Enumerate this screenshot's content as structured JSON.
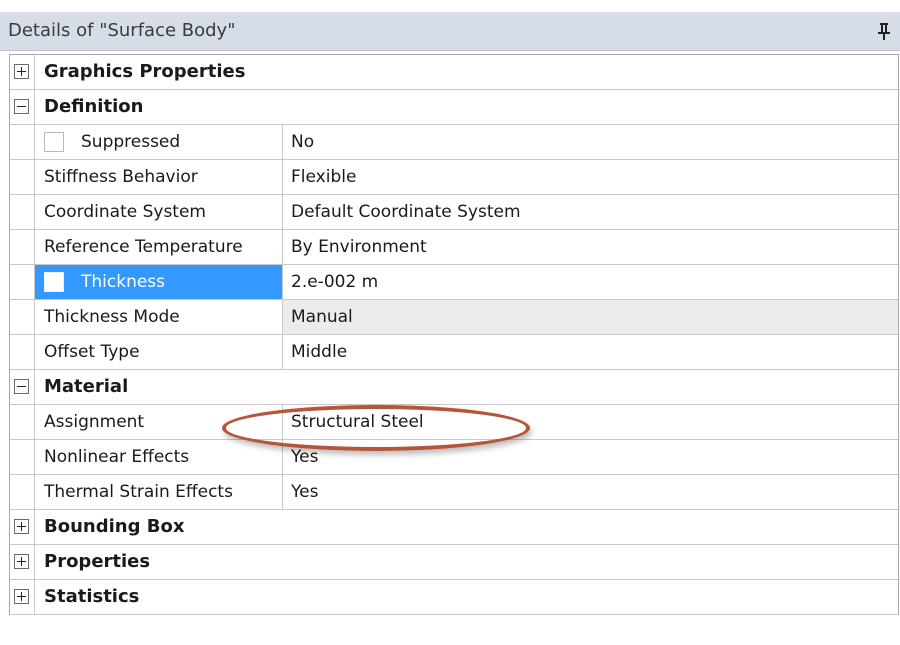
{
  "panel": {
    "title": "Details of \"Surface Body\""
  },
  "groups": {
    "graphics_properties": "Graphics Properties",
    "definition": "Definition",
    "material": "Material",
    "bounding_box": "Bounding Box",
    "properties": "Properties",
    "statistics": "Statistics"
  },
  "definition": {
    "suppressed_label": "Suppressed",
    "suppressed_value": "No",
    "stiffness_label": "Stiffness Behavior",
    "stiffness_value": "Flexible",
    "coordinate_label": "Coordinate System",
    "coordinate_value": "Default Coordinate System",
    "reftemp_label": "Reference Temperature",
    "reftemp_value": "By Environment",
    "thickness_label": "Thickness",
    "thickness_value": "2.e-002 m",
    "thickness_mode_label": "Thickness Mode",
    "thickness_mode_value": "Manual",
    "offset_label": "Offset Type",
    "offset_value": "Middle"
  },
  "material": {
    "assignment_label": "Assignment",
    "assignment_value": "Structural Steel",
    "nonlinear_label": "Nonlinear Effects",
    "nonlinear_value": "Yes",
    "thermal_label": "Thermal Strain Effects",
    "thermal_value": "Yes"
  },
  "colors": {
    "selection": "#3399ff",
    "annotation_ellipse": "#b5563a",
    "title_bar": "#d7dde6"
  }
}
